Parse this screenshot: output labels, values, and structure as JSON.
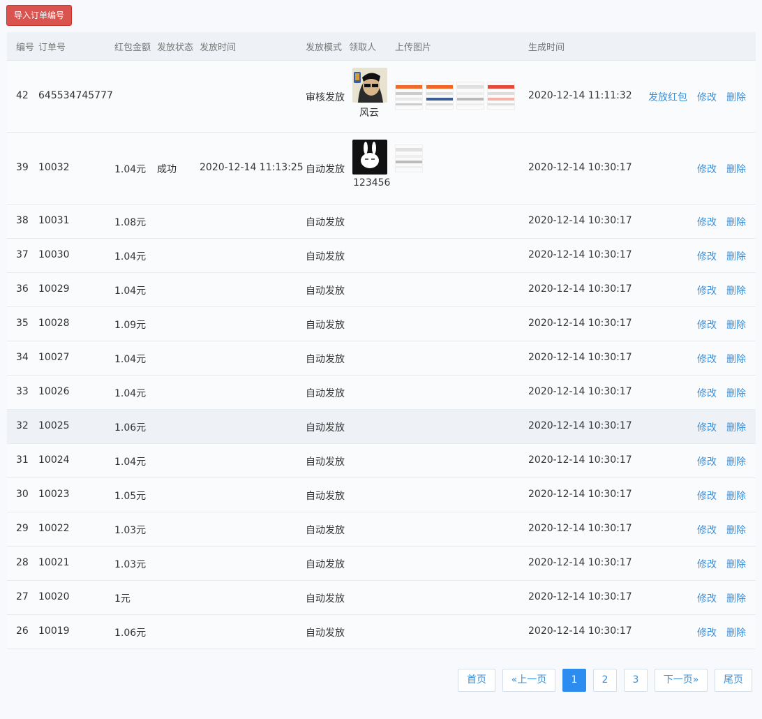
{
  "toolbar": {
    "import_label": "导入订单编号"
  },
  "table": {
    "headers": {
      "id": "编号",
      "order": "订单号",
      "amount": "红包金额",
      "status": "发放状态",
      "sent_time": "发放时间",
      "mode": "发放模式",
      "receiver": "领取人",
      "images": "上传图片",
      "created": "生成时间"
    },
    "rows": [
      {
        "id": "42",
        "order": "645534745777",
        "amount": "",
        "status": "",
        "sent_time": "",
        "mode": "审核发放",
        "receiver": "风云",
        "receiver_avatar": "sunglasses-man-avatar",
        "images": 4,
        "created": "2020-12-14 11:11:32",
        "send": "发放红包",
        "edit": "修改",
        "delete": "删除"
      },
      {
        "id": "39",
        "order": "10032",
        "amount": "1.04元",
        "status": "成功",
        "sent_time": "2020-12-14 11:13:25",
        "mode": "自动发放",
        "receiver": "123456",
        "receiver_avatar": "rabbit-avatar",
        "images": 1,
        "created": "2020-12-14 10:30:17",
        "edit": "修改",
        "delete": "删除"
      },
      {
        "id": "38",
        "order": "10031",
        "amount": "1.08元",
        "mode": "自动发放",
        "created": "2020-12-14 10:30:17",
        "edit": "修改",
        "delete": "删除"
      },
      {
        "id": "37",
        "order": "10030",
        "amount": "1.04元",
        "mode": "自动发放",
        "created": "2020-12-14 10:30:17",
        "edit": "修改",
        "delete": "删除"
      },
      {
        "id": "36",
        "order": "10029",
        "amount": "1.04元",
        "mode": "自动发放",
        "created": "2020-12-14 10:30:17",
        "edit": "修改",
        "delete": "删除"
      },
      {
        "id": "35",
        "order": "10028",
        "amount": "1.09元",
        "mode": "自动发放",
        "created": "2020-12-14 10:30:17",
        "edit": "修改",
        "delete": "删除"
      },
      {
        "id": "34",
        "order": "10027",
        "amount": "1.04元",
        "mode": "自动发放",
        "created": "2020-12-14 10:30:17",
        "edit": "修改",
        "delete": "删除"
      },
      {
        "id": "33",
        "order": "10026",
        "amount": "1.04元",
        "mode": "自动发放",
        "created": "2020-12-14 10:30:17",
        "edit": "修改",
        "delete": "删除"
      },
      {
        "id": "32",
        "order": "10025",
        "amount": "1.06元",
        "mode": "自动发放",
        "created": "2020-12-14 10:30:17",
        "edit": "修改",
        "delete": "删除"
      },
      {
        "id": "31",
        "order": "10024",
        "amount": "1.04元",
        "mode": "自动发放",
        "created": "2020-12-14 10:30:17",
        "edit": "修改",
        "delete": "删除"
      },
      {
        "id": "30",
        "order": "10023",
        "amount": "1.05元",
        "mode": "自动发放",
        "created": "2020-12-14 10:30:17",
        "edit": "修改",
        "delete": "删除"
      },
      {
        "id": "29",
        "order": "10022",
        "amount": "1.03元",
        "mode": "自动发放",
        "created": "2020-12-14 10:30:17",
        "edit": "修改",
        "delete": "删除"
      },
      {
        "id": "28",
        "order": "10021",
        "amount": "1.03元",
        "mode": "自动发放",
        "created": "2020-12-14 10:30:17",
        "edit": "修改",
        "delete": "删除"
      },
      {
        "id": "27",
        "order": "10020",
        "amount": "1元",
        "mode": "自动发放",
        "created": "2020-12-14 10:30:17",
        "edit": "修改",
        "delete": "删除"
      },
      {
        "id": "26",
        "order": "10019",
        "amount": "1.06元",
        "mode": "自动发放",
        "created": "2020-12-14 10:30:17",
        "edit": "修改",
        "delete": "删除"
      }
    ]
  },
  "pagination": {
    "first": "首页",
    "prev": "«上一页",
    "pages": [
      "1",
      "2",
      "3"
    ],
    "current": "1",
    "next": "下一页»",
    "last": "尾页"
  },
  "colors": {
    "danger": "#d9534f",
    "link": "#3b8fd8",
    "active_page": "#2d8cf0"
  }
}
